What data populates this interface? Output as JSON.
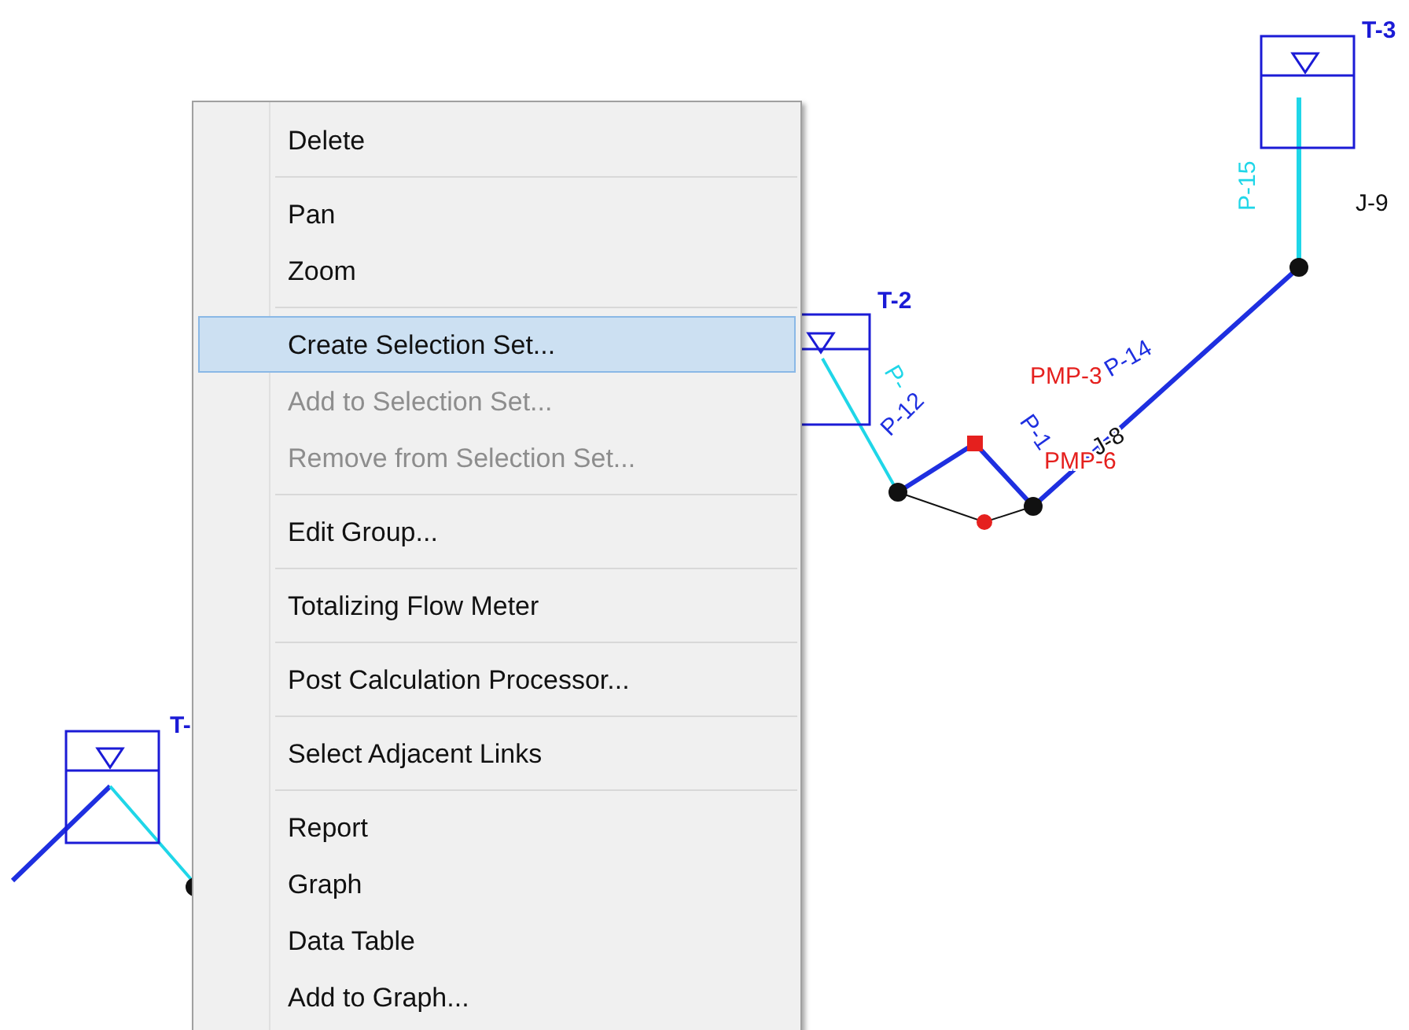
{
  "canvas": {
    "labels": [
      {
        "text": "T-3",
        "kind": "tank"
      },
      {
        "text": "P-15",
        "kind": "pipe_cyan"
      },
      {
        "text": "J-9",
        "kind": "junction"
      },
      {
        "text": "T-2",
        "kind": "tank"
      },
      {
        "text": "P-",
        "kind": "pipe_cyan"
      },
      {
        "text": "P-12",
        "kind": "pipe"
      },
      {
        "text": "P-14",
        "kind": "pipe"
      },
      {
        "text": "PMP-3",
        "kind": "pump"
      },
      {
        "text": "PMP-6",
        "kind": "pump"
      },
      {
        "text": "P-1",
        "kind": "pipe"
      },
      {
        "text": "J-8",
        "kind": "junction"
      },
      {
        "text": "T-",
        "kind": "tank"
      }
    ]
  },
  "menu": {
    "items": [
      {
        "kind": "item",
        "label": "Delete",
        "disabled": false,
        "selected": false
      },
      {
        "kind": "separator"
      },
      {
        "kind": "item",
        "label": "Pan",
        "disabled": false,
        "selected": false
      },
      {
        "kind": "item",
        "label": "Zoom",
        "disabled": false,
        "selected": false
      },
      {
        "kind": "separator"
      },
      {
        "kind": "item",
        "label": "Create Selection Set...",
        "disabled": false,
        "selected": true
      },
      {
        "kind": "item",
        "label": "Add to Selection Set...",
        "disabled": true,
        "selected": false
      },
      {
        "kind": "item",
        "label": "Remove from Selection Set...",
        "disabled": true,
        "selected": false
      },
      {
        "kind": "separator"
      },
      {
        "kind": "item",
        "label": "Edit Group...",
        "disabled": false,
        "selected": false
      },
      {
        "kind": "separator"
      },
      {
        "kind": "item",
        "label": "Totalizing Flow Meter",
        "disabled": false,
        "selected": false
      },
      {
        "kind": "separator"
      },
      {
        "kind": "item",
        "label": "Post Calculation Processor...",
        "disabled": false,
        "selected": false
      },
      {
        "kind": "separator"
      },
      {
        "kind": "item",
        "label": "Select Adjacent Links",
        "disabled": false,
        "selected": false
      },
      {
        "kind": "separator"
      },
      {
        "kind": "item",
        "label": "Report",
        "disabled": false,
        "selected": false
      },
      {
        "kind": "item",
        "label": "Graph",
        "disabled": false,
        "selected": false
      },
      {
        "kind": "item",
        "label": "Data Table",
        "disabled": false,
        "selected": false
      },
      {
        "kind": "item",
        "label": "Add to Graph...",
        "disabled": false,
        "selected": false
      }
    ]
  }
}
